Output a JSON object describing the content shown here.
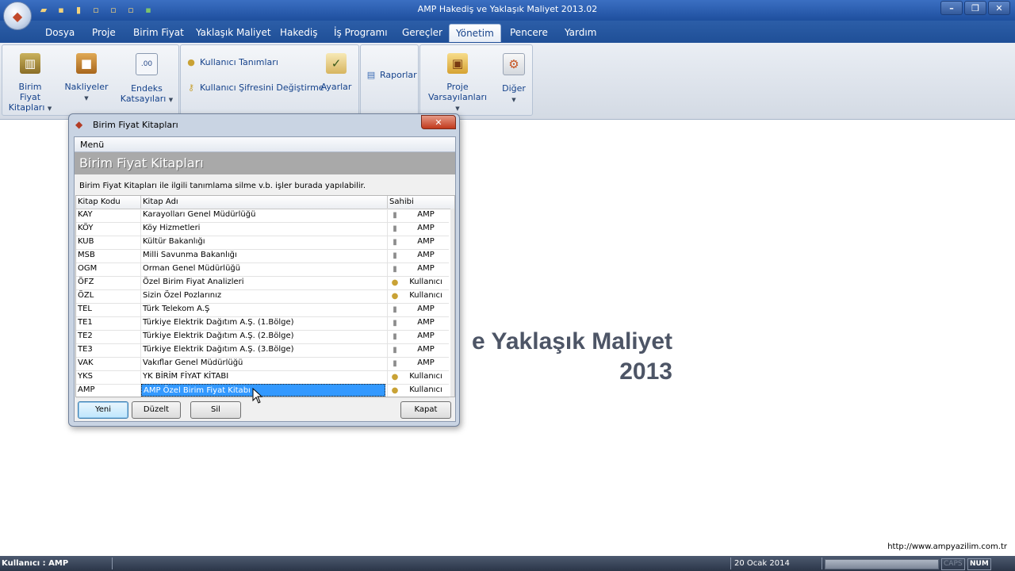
{
  "app": {
    "title": "AMP Hakediş ve Yaklaşık Maliyet 2013.02"
  },
  "menu": {
    "tabs": [
      "Dosya",
      "Proje",
      "Birim Fiyat",
      "Yaklaşık Maliyet",
      "Hakediş",
      "İş Programı",
      "Gereçler",
      "Yönetim",
      "Pencere",
      "Yardım"
    ],
    "active_tab": "Yönetim"
  },
  "ribbon": {
    "birim_fiyat_l1": "Birim Fiyat",
    "birim_fiyat_l2": "Kitapları",
    "nakliyeler": "Nakliyeler",
    "endeks_l1": "Endeks",
    "endeks_l2": "Katsayıları",
    "kullanici_tanimlari": "Kullanıcı Tanımları",
    "kullanici_sifre": "Kullanıcı Şifresini Değiştirme",
    "ayarlar": "Ayarlar",
    "raporlar": "Raporlar",
    "proje_l1": "Proje",
    "proje_l2": "Varsayılanları",
    "diger": "Diğer"
  },
  "background": {
    "brand_line1": "e Yaklaşık Maliyet",
    "brand_line2": "2013",
    "website": "http://www.ampyazilim.com.tr"
  },
  "dialog": {
    "title": "Birim Fiyat Kitapları",
    "menu_label": "Menü",
    "header": "Birim Fiyat Kitapları",
    "description": "Birim Fiyat Kitapları ile ilgili tanımlama silme v.b. işler burada yapılabilir.",
    "columns": {
      "kod": "Kitap Kodu",
      "ad": "Kitap Adı",
      "sahibi": "Sahibi"
    },
    "rows": [
      {
        "kod": "KAY",
        "ad": "Karayolları Genel Müdürlüğü",
        "sahibi": "AMP",
        "icon": "book-icon"
      },
      {
        "kod": "KÖY",
        "ad": "Köy Hizmetleri",
        "sahibi": "AMP",
        "icon": "book-icon"
      },
      {
        "kod": "KUB",
        "ad": "Kültür Bakanlığı",
        "sahibi": "AMP",
        "icon": "book-icon"
      },
      {
        "kod": "MSB",
        "ad": "Milli Savunma Bakanlığı",
        "sahibi": "AMP",
        "icon": "book-icon"
      },
      {
        "kod": "OGM",
        "ad": "Orman Genel Müdürlüğü",
        "sahibi": "AMP",
        "icon": "book-icon"
      },
      {
        "kod": "ÖFZ",
        "ad": "Özel Birim Fiyat Analizleri",
        "sahibi": "Kullanıcı",
        "icon": "user-icon"
      },
      {
        "kod": "ÖZL",
        "ad": "Sizin Özel Pozlarınız",
        "sahibi": "Kullanıcı",
        "icon": "user-icon"
      },
      {
        "kod": "TEL",
        "ad": "Türk Telekom A.Ş",
        "sahibi": "AMP",
        "icon": "book-icon"
      },
      {
        "kod": "TE1",
        "ad": "Türkiye Elektrik Dağıtım A.Ş. (1.Bölge)",
        "sahibi": "AMP",
        "icon": "book-icon"
      },
      {
        "kod": "TE2",
        "ad": "Türkiye Elektrik Dağıtım A.Ş. (2.Bölge)",
        "sahibi": "AMP",
        "icon": "book-icon"
      },
      {
        "kod": "TE3",
        "ad": "Türkiye Elektrik Dağıtım A.Ş. (3.Bölge)",
        "sahibi": "AMP",
        "icon": "book-icon"
      },
      {
        "kod": "VAK",
        "ad": "Vakıflar Genel Müdürlüğü",
        "sahibi": "AMP",
        "icon": "book-icon"
      },
      {
        "kod": "YKS",
        "ad": "YK BİRİM FİYAT KİTABI",
        "sahibi": "Kullanıcı",
        "icon": "user-icon"
      },
      {
        "kod": "AMP",
        "ad": "AMP Özel Birim Fiyat Kitabı",
        "sahibi": "Kullanıcı",
        "icon": "user-icon",
        "selected": true
      }
    ],
    "buttons": {
      "yeni": "Yeni",
      "duzelt": "Düzelt",
      "sil": "Sil",
      "kapat": "Kapat"
    }
  },
  "statusbar": {
    "user": "Kullanıcı : AMP",
    "date": "20 Ocak 2014",
    "caps": "CAPS",
    "num": "NUM"
  },
  "colors": {
    "title_blue": "#1e4f9e",
    "selection": "#3399ff",
    "close_red": "#c1391c"
  }
}
